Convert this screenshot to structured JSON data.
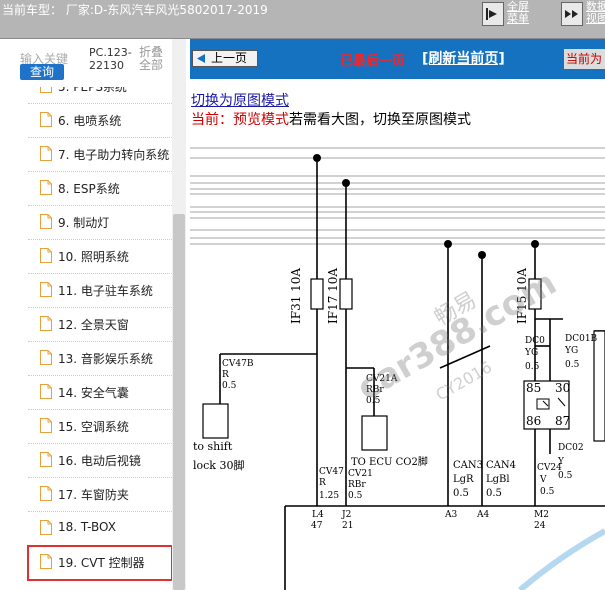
{
  "header": {
    "title": "当前车型：  厂家:D-东风汽车风光5802017-2019",
    "fullscreen_label": "全屏\n菜单",
    "data_label": "数据\n视图"
  },
  "sidebar": {
    "search_placeholder": "输入关键",
    "query_button": "查询",
    "pc_code": "PC.123-22130",
    "collapse_label": "折叠全部",
    "items": [
      {
        "label": "5. PEPS系统"
      },
      {
        "label": "6. 电喷系统"
      },
      {
        "label": "7. 电子助力转向系统"
      },
      {
        "label": "8. ESP系统"
      },
      {
        "label": "9. 制动灯"
      },
      {
        "label": "10. 照明系统"
      },
      {
        "label": "11. 电子驻车系统"
      },
      {
        "label": "12. 全景天窗"
      },
      {
        "label": "13. 音影娱乐系统"
      },
      {
        "label": "14. 安全气囊"
      },
      {
        "label": "15. 空调系统"
      },
      {
        "label": "16. 电动后视镜"
      },
      {
        "label": "17. 车窗防夹"
      },
      {
        "label": "18. T-BOX"
      },
      {
        "label": "19. CVT 控制器"
      }
    ]
  },
  "main": {
    "prev_button": "上一页",
    "last_page": "已最后一页",
    "refresh": "[刷新当前页]",
    "current_tag": "当前为",
    "switch_link": "切换为原图模式",
    "mode_prefix": "当前：预览模式",
    "mode_suffix": "若需看大图，切换至原图模式"
  },
  "diagram": {
    "fuses": [
      "IF31 10A",
      "IF17 10A",
      "IF15 10A"
    ],
    "labels": {
      "cv47b": "CV47B",
      "cv47b_color": "R",
      "cv47b_size": "0.5",
      "to_shift": "to shift",
      "lock_pin": "lock 30脚",
      "cv47": "CV47",
      "cv47_color": "R",
      "cv47_size": "1.25",
      "cv21a": "CV21A",
      "cv21a_color": "RBr",
      "cv21a_size": "0.5",
      "to_ecu": "TO ECU CO2脚",
      "cv21": "CV21",
      "cv21_color": "RBr",
      "cv21_size": "0.5",
      "can3": "CAN3",
      "can3_color": "LgR",
      "can3_size": "0.5",
      "can4": "CAN4",
      "can4_color": "LgBl",
      "can4_size": "0.5",
      "dc01a": "DC0",
      "dc01a_color": "YG",
      "dc01a_size": "0.5",
      "dc01b": "DC01B",
      "dc01b_color": "YG",
      "dc01b_size": "0.5",
      "relay_85": "85",
      "relay_30": "30",
      "relay_86": "86",
      "relay_87": "87",
      "dc02": "DC02",
      "dc02_color": "Y",
      "dc02_size": "0.5",
      "cv24": "CV24",
      "cv24_color": "V",
      "cv24_size": "0.5",
      "pin_l4": "L4",
      "pin_47": "47",
      "pin_j2": "J2",
      "pin_21": "21",
      "pin_a3": "A3",
      "pin_a4": "A4",
      "pin_m2": "M2",
      "pin_24": "24"
    },
    "watermark_1": "畅易",
    "watermark_2": "car388.com",
    "watermark_3": "CY2016"
  }
}
